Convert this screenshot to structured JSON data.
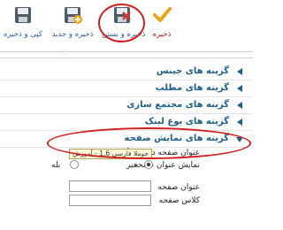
{
  "toolbar": {
    "save_label": "ذخیره",
    "save_close_label": "ذخیره و بستن",
    "save_new_label": "ذخیره و جدید",
    "save_copy_label": "کپی و ذخیره"
  },
  "panels": [
    {
      "title": "گزینه های جینس"
    },
    {
      "title": "گزینه های مطلب"
    },
    {
      "title": "گزینه های مجتمع سازی"
    },
    {
      "title": "گزینه های بوع لینک"
    },
    {
      "title": "گزینه های نمایش صفحه"
    }
  ],
  "page_display": {
    "browser_title_label": "عنوان صفحه در مرورگر",
    "tooltip": "جوملا فارسی 1.6 - آموزش",
    "show_page_title_label": "نمایش عنوان صفحه",
    "radio_no": "خیر",
    "radio_yes": "بله",
    "page_title_label": "عنوان صفحه",
    "page_class_label": "کلاس صفحه"
  },
  "watermark": "www.joomlafarsi.com"
}
